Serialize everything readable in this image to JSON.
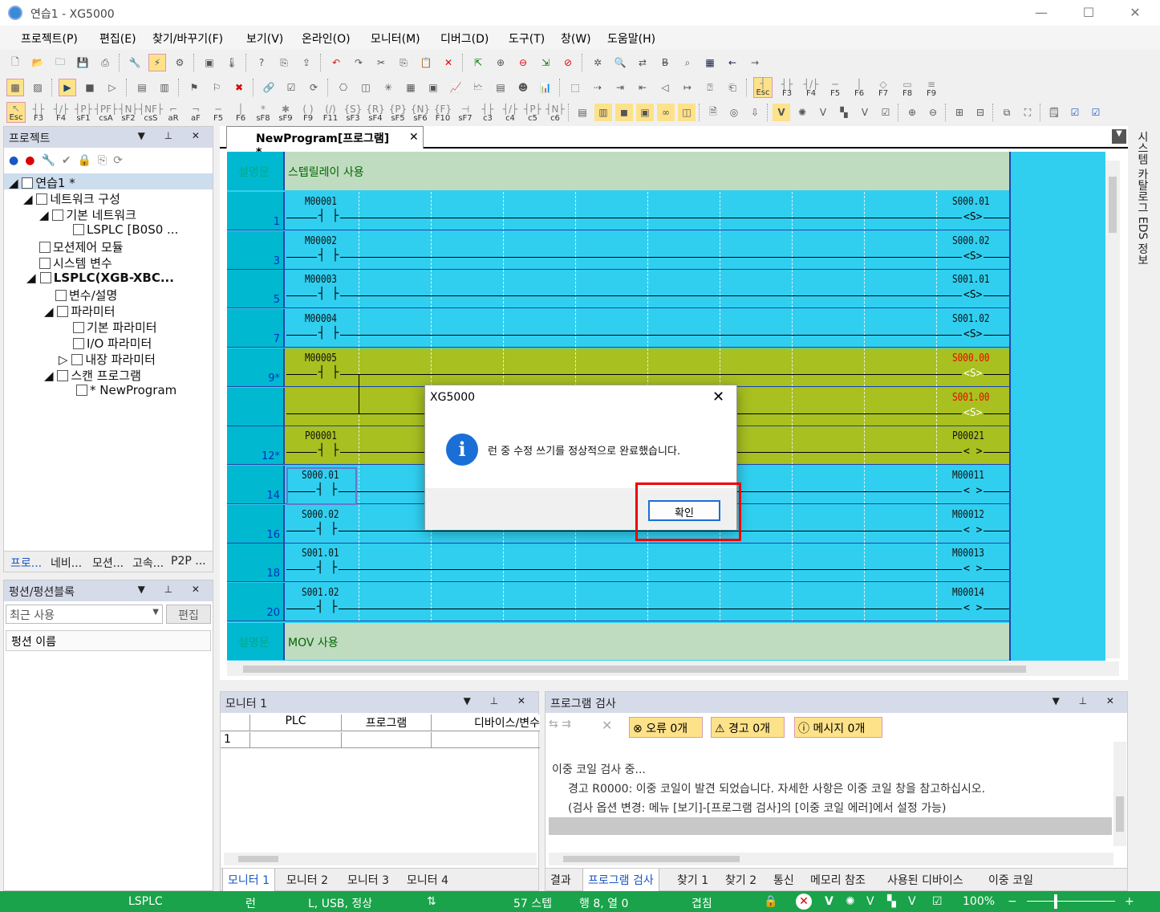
{
  "window": {
    "title": "연습1 - XG5000"
  },
  "menu": [
    "프로젝트(P)",
    "편집(E)",
    "찾기/바꾸기(F)",
    "보기(V)",
    "온라인(O)",
    "모니터(M)",
    "디버그(D)",
    "도구(T)",
    "창(W)",
    "도움말(H)"
  ],
  "fkeys": {
    "row2": [
      "Esc",
      "F3",
      "F4",
      "F5",
      "F6",
      "F7",
      "F8",
      "F9"
    ],
    "row3": [
      "Esc",
      "F3",
      "F4",
      "sF1",
      "csA",
      "sF2",
      "csS",
      "aR",
      "aF",
      "F5",
      "F6",
      "sF8",
      "sF9",
      "F9",
      "F11",
      "sF3",
      "sF4",
      "sF5",
      "sF6",
      "F10",
      "sF7",
      "c3",
      "c4",
      "c5",
      "c6"
    ]
  },
  "project_panel": {
    "title": "프로젝트",
    "tree": [
      "연습1 *",
      "네트워크 구성",
      "기본 네트워크",
      "LSPLC [B0S0 ...",
      "모션제어 모듈",
      "시스템 변수",
      "LSPLC(XGB-XBC...",
      "변수/설명",
      "파라미터",
      "기본 파라미터",
      "I/O 파라미터",
      "내장 파라미터",
      "스캔 프로그램",
      "* NewProgram"
    ],
    "tabs": [
      "프로...",
      "네비...",
      "모션...",
      "고속...",
      "P2P ..."
    ]
  },
  "fb_panel": {
    "title": "펑션/펑션블록",
    "combo": "최근 사용",
    "edit_btn": "편집",
    "col": "펑션 이름"
  },
  "editor": {
    "tab": "NewProgram[프로그램] *",
    "right_tab": "시스템 카탈로그   EDS 정보",
    "comment1_label": "설명문",
    "comment1_text": "스텝릴레이 사용",
    "comment2_label": "설명문",
    "comment2_text": "MOV 사용",
    "rungs": [
      {
        "num": "1",
        "contact": "M00001",
        "coil": "S000.01",
        "coil_sym": "<S>"
      },
      {
        "num": "3",
        "contact": "M00002",
        "coil": "S000.02",
        "coil_sym": "<S>"
      },
      {
        "num": "5",
        "contact": "M00003",
        "coil": "S001.01",
        "coil_sym": "<S>"
      },
      {
        "num": "7",
        "contact": "M00004",
        "coil": "S001.02",
        "coil_sym": "<S>"
      },
      {
        "num": "9*",
        "contact": "M00005",
        "coil": "S000.00",
        "coil_sym": "<S>"
      },
      {
        "num": "",
        "contact": "",
        "coil": "S001.00",
        "coil_sym": "<S>"
      },
      {
        "num": "12*",
        "contact": "P00001",
        "coil": "P00021",
        "coil_sym": "<  >"
      },
      {
        "num": "14",
        "contact": "S000.01",
        "coil": "M00011",
        "coil_sym": "<  >"
      },
      {
        "num": "16",
        "contact": "S000.02",
        "coil": "M00012",
        "coil_sym": "<  >"
      },
      {
        "num": "18",
        "contact": "S001.01",
        "coil": "M00013",
        "coil_sym": "<  >"
      },
      {
        "num": "20",
        "contact": "S001.02",
        "coil": "M00014",
        "coil_sym": "<  >"
      }
    ]
  },
  "dialog": {
    "title": "XG5000",
    "message": "런 중 수정 쓰기를 정상적으로 완료했습니다.",
    "ok": "확인"
  },
  "monitor": {
    "title": "모니터 1",
    "cols": [
      "PLC",
      "프로그램",
      "디바이스/변수"
    ],
    "row1": "1",
    "tabs": [
      "모니터 1",
      "모니터 2",
      "모니터 3",
      "모니터 4"
    ]
  },
  "check": {
    "title": "프로그램 검사",
    "err": "오류 0개",
    "warn": "경고 0개",
    "msg": "메시지 0개",
    "lines": [
      "이중 코일 검사 중...",
      "경고 R0000: 이중 코일이 발견 되었습니다. 자세한 사항은 이중 코일 창을 참고하십시오.",
      "(검사 옵션 변경: 메뉴 [보기]-[프로그램 검사]의 [이중 코일 에러]에서 설정 가능)"
    ],
    "tabs": [
      "결과",
      "프로그램 검사",
      "찾기 1",
      "찾기 2",
      "통신",
      "메모리 참조",
      "사용된 디바이스",
      "이중 코일"
    ]
  },
  "status": {
    "plc": "LSPLC",
    "mode": "런",
    "conn": "L, USB, 정상",
    "steps": "57 스텝",
    "pos": "행 8, 열 0",
    "ovr": "겹침",
    "zoom": "100%"
  },
  "colors": {
    "rung_bg": "#30cff0",
    "highlight": "#a8c020",
    "comment_bg": "#c0dcc0",
    "status": "#1aa34a"
  }
}
